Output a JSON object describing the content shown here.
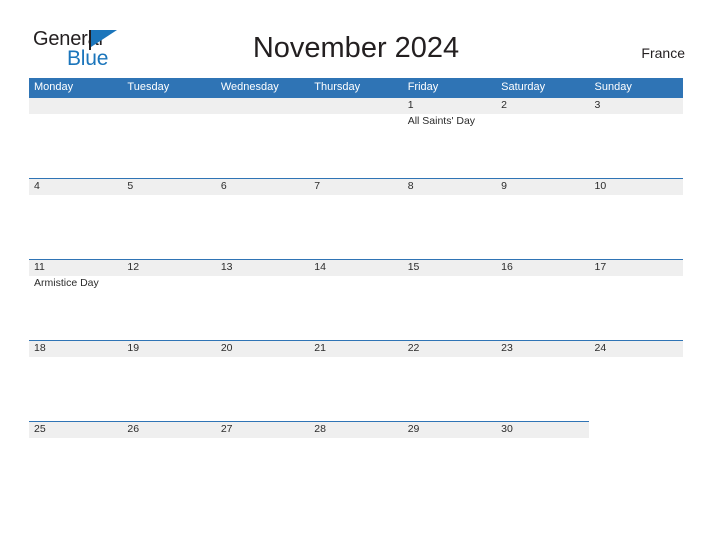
{
  "brand": {
    "line1": "General",
    "line2": "Blue",
    "flag_color": "#1b75bb",
    "icon": "flag-triangle-icon"
  },
  "header": {
    "title": "November 2024",
    "country": "France"
  },
  "calendar": {
    "header_bg": "#2f74b5",
    "band_bg": "#efefef",
    "weekdays": [
      "Monday",
      "Tuesday",
      "Wednesday",
      "Thursday",
      "Friday",
      "Saturday",
      "Sunday"
    ],
    "weeks": [
      {
        "band_width": 654,
        "days": [
          {
            "num": "",
            "event": ""
          },
          {
            "num": "",
            "event": ""
          },
          {
            "num": "",
            "event": ""
          },
          {
            "num": "",
            "event": ""
          },
          {
            "num": "1",
            "event": "All Saints' Day"
          },
          {
            "num": "2",
            "event": ""
          },
          {
            "num": "3",
            "event": ""
          }
        ]
      },
      {
        "band_width": 654,
        "days": [
          {
            "num": "4",
            "event": ""
          },
          {
            "num": "5",
            "event": ""
          },
          {
            "num": "6",
            "event": ""
          },
          {
            "num": "7",
            "event": ""
          },
          {
            "num": "8",
            "event": ""
          },
          {
            "num": "9",
            "event": ""
          },
          {
            "num": "10",
            "event": ""
          }
        ]
      },
      {
        "band_width": 654,
        "days": [
          {
            "num": "11",
            "event": "Armistice Day"
          },
          {
            "num": "12",
            "event": ""
          },
          {
            "num": "13",
            "event": ""
          },
          {
            "num": "14",
            "event": ""
          },
          {
            "num": "15",
            "event": ""
          },
          {
            "num": "16",
            "event": ""
          },
          {
            "num": "17",
            "event": ""
          }
        ]
      },
      {
        "band_width": 654,
        "days": [
          {
            "num": "18",
            "event": ""
          },
          {
            "num": "19",
            "event": ""
          },
          {
            "num": "20",
            "event": ""
          },
          {
            "num": "21",
            "event": ""
          },
          {
            "num": "22",
            "event": ""
          },
          {
            "num": "23",
            "event": ""
          },
          {
            "num": "24",
            "event": ""
          }
        ]
      },
      {
        "band_width": 560,
        "days": [
          {
            "num": "25",
            "event": ""
          },
          {
            "num": "26",
            "event": ""
          },
          {
            "num": "27",
            "event": ""
          },
          {
            "num": "28",
            "event": ""
          },
          {
            "num": "29",
            "event": ""
          },
          {
            "num": "30",
            "event": ""
          },
          {
            "num": "",
            "event": ""
          }
        ]
      }
    ]
  }
}
